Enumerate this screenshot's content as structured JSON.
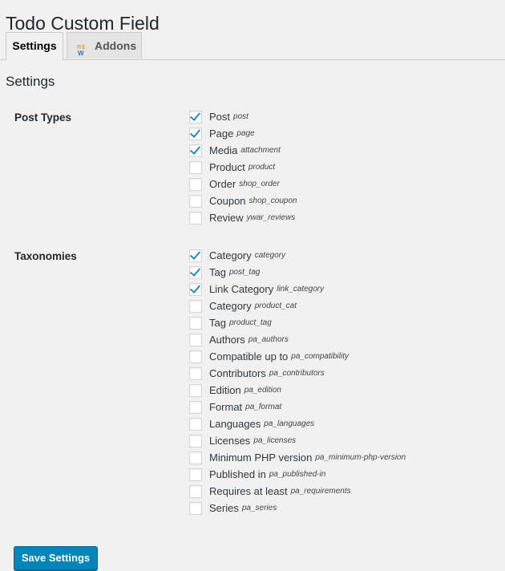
{
  "page": {
    "title": "Todo Custom Field"
  },
  "tabs": [
    {
      "label": "Settings",
      "active": true
    },
    {
      "label": "Addons",
      "active": false,
      "icon": "rew-logo-icon"
    }
  ],
  "section_title": "Settings",
  "post_types": {
    "label": "Post Types",
    "items": [
      {
        "label": "Post",
        "slug": "post",
        "checked": true
      },
      {
        "label": "Page",
        "slug": "page",
        "checked": true
      },
      {
        "label": "Media",
        "slug": "attachment",
        "checked": true
      },
      {
        "label": "Product",
        "slug": "product",
        "checked": false
      },
      {
        "label": "Order",
        "slug": "shop_order",
        "checked": false
      },
      {
        "label": "Coupon",
        "slug": "shop_coupon",
        "checked": false
      },
      {
        "label": "Review",
        "slug": "ywar_reviews",
        "checked": false
      }
    ]
  },
  "taxonomies": {
    "label": "Taxonomies",
    "items": [
      {
        "label": "Category",
        "slug": "category",
        "checked": true
      },
      {
        "label": "Tag",
        "slug": "post_tag",
        "checked": true
      },
      {
        "label": "Link Category",
        "slug": "link_category",
        "checked": true
      },
      {
        "label": "Category",
        "slug": "product_cat",
        "checked": false
      },
      {
        "label": "Tag",
        "slug": "product_tag",
        "checked": false
      },
      {
        "label": "Authors",
        "slug": "pa_authors",
        "checked": false
      },
      {
        "label": "Compatible up to",
        "slug": "pa_compatibility",
        "checked": false
      },
      {
        "label": "Contributors",
        "slug": "pa_contributors",
        "checked": false
      },
      {
        "label": "Edition",
        "slug": "pa_edition",
        "checked": false
      },
      {
        "label": "Format",
        "slug": "pa_format",
        "checked": false
      },
      {
        "label": "Languages",
        "slug": "pa_languages",
        "checked": false
      },
      {
        "label": "Licenses",
        "slug": "pa_licenses",
        "checked": false
      },
      {
        "label": "Minimum PHP version",
        "slug": "pa_minimum-php-version",
        "checked": false
      },
      {
        "label": "Published in",
        "slug": "pa_published-in",
        "checked": false
      },
      {
        "label": "Requires at least",
        "slug": "pa_requirements",
        "checked": false
      },
      {
        "label": "Series",
        "slug": "pa_series",
        "checked": false
      }
    ]
  },
  "save_button": {
    "label": "Save Settings"
  },
  "colors": {
    "accent": "#0085ba",
    "check": "#1e8cbe",
    "background": "#f1f1f1"
  }
}
